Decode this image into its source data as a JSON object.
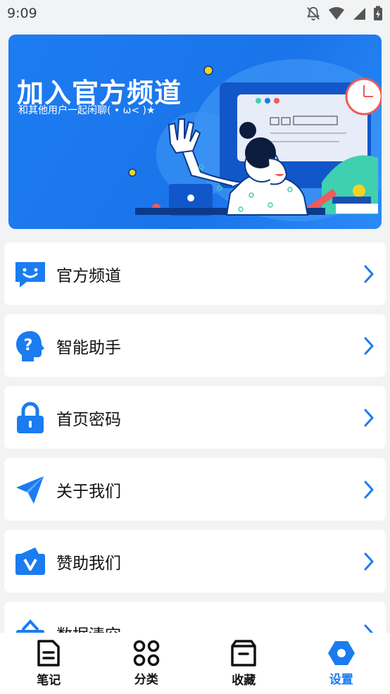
{
  "status_bar": {
    "time": "9:09"
  },
  "banner": {
    "title": "加入官方频道",
    "subtitle": "和其他用户一起闲聊( • ω< )★"
  },
  "menu": [
    {
      "label": "官方频道",
      "icon": "chat-smile-icon"
    },
    {
      "label": "智能助手",
      "icon": "assistant-head-icon"
    },
    {
      "label": "首页密码",
      "icon": "lock-icon"
    },
    {
      "label": "关于我们",
      "icon": "paper-plane-icon"
    },
    {
      "label": "赞助我们",
      "icon": "wallet-icon"
    },
    {
      "label": "数据清空",
      "icon": "basket-icon"
    }
  ],
  "bottom_nav": [
    {
      "label": "笔记",
      "icon": "note-icon"
    },
    {
      "label": "分类",
      "icon": "category-icon"
    },
    {
      "label": "收藏",
      "icon": "box-icon"
    },
    {
      "label": "设置",
      "icon": "settings-hex-icon",
      "active": true
    }
  ],
  "colors": {
    "accent": "#1a7cf0",
    "background": "#f2f3f5"
  }
}
